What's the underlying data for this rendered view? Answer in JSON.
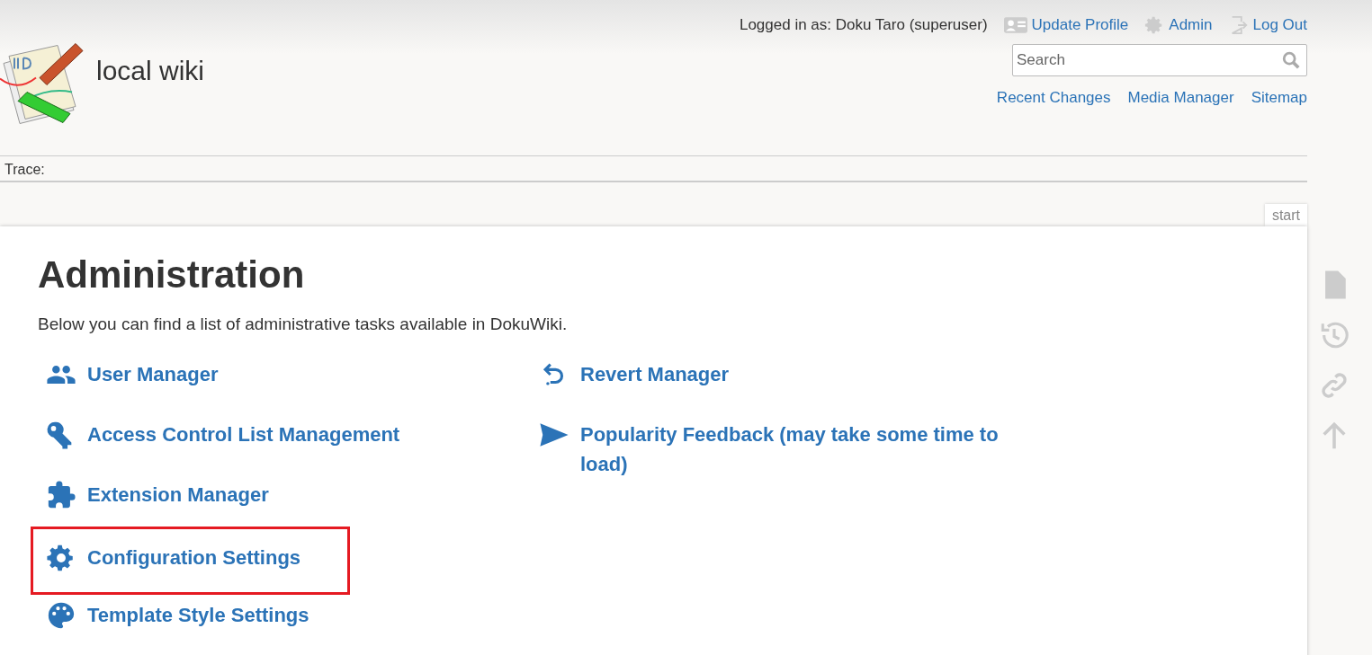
{
  "header": {
    "site_title": "local wiki",
    "user_info": "Logged in as: Doku Taro (superuser)",
    "user_tools": [
      {
        "kind": "profile",
        "label": "Update Profile"
      },
      {
        "kind": "admin",
        "label": "Admin"
      },
      {
        "kind": "logout",
        "label": "Log Out"
      }
    ],
    "search": {
      "placeholder": "Search"
    },
    "site_tools": [
      "Recent Changes",
      "Media Manager",
      "Sitemap"
    ]
  },
  "trace": {
    "label": "Trace:"
  },
  "page_id": "start",
  "content": {
    "title": "Administration",
    "intro": "Below you can find a list of administrative tasks available in DokuWiki.",
    "columns": [
      [
        {
          "kind": "users",
          "label": "User Manager",
          "highlighted": false
        },
        {
          "kind": "key",
          "label": "Access Control List Management",
          "highlighted": false
        },
        {
          "kind": "puzzle",
          "label": "Extension Manager",
          "highlighted": false
        },
        {
          "kind": "gear",
          "label": "Configuration Settings",
          "highlighted": true
        },
        {
          "kind": "palette",
          "label": "Template Style Settings",
          "highlighted": false
        }
      ],
      [
        {
          "kind": "revert",
          "label": "Revert Manager",
          "highlighted": false
        },
        {
          "kind": "send",
          "label": "Popularity Feedback (may take some time to load)",
          "highlighted": false
        }
      ]
    ]
  },
  "page_tools": [
    {
      "kind": "document"
    },
    {
      "kind": "history"
    },
    {
      "kind": "link"
    },
    {
      "kind": "top"
    }
  ]
}
